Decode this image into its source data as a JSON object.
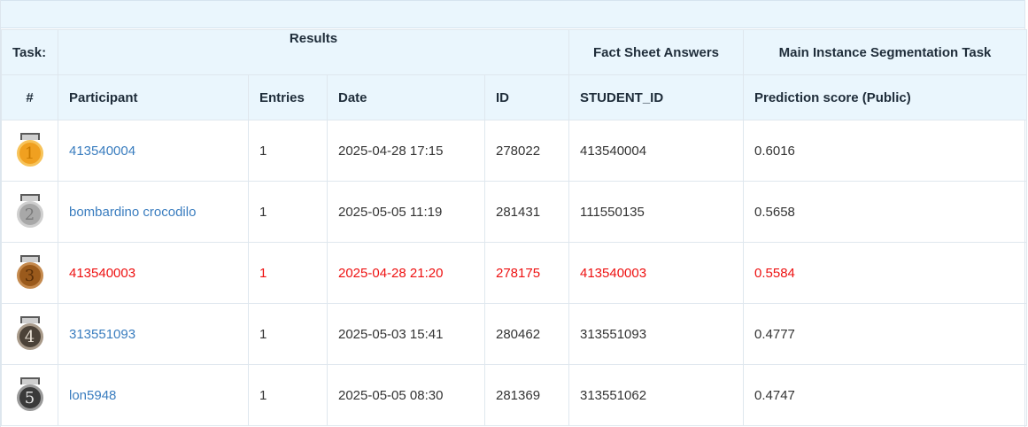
{
  "header": {
    "task_label": "Task:",
    "results_label": "Results",
    "fact_sheet_label": "Fact Sheet Answers",
    "main_task_label": "Main Instance Segmentation Task"
  },
  "columns": {
    "rank": "#",
    "participant": "Participant",
    "entries": "Entries",
    "date": "Date",
    "id": "ID",
    "student_id": "STUDENT_ID",
    "score": "Prediction score (Public)"
  },
  "rows": [
    {
      "rank": "1",
      "medal": "gold-medal-icon",
      "participant": "413540004",
      "entries": "1",
      "date": "2025-04-28 17:15",
      "id": "278022",
      "student_id": "413540004",
      "score": "0.6016"
    },
    {
      "rank": "2",
      "medal": "silver-medal-icon",
      "participant": "bombardino crocodilo",
      "entries": "1",
      "date": "2025-05-05 11:19",
      "id": "281431",
      "student_id": "111550135",
      "score": "0.5658"
    },
    {
      "rank": "3",
      "medal": "bronze-medal-icon",
      "participant": "413540003",
      "entries": "1",
      "date": "2025-04-28 21:20",
      "id": "278175",
      "student_id": "413540003",
      "score": "0.5584"
    },
    {
      "rank": "4",
      "medal": "rank-4-medal-icon",
      "participant": "313551093",
      "entries": "1",
      "date": "2025-05-03 15:41",
      "id": "280462",
      "student_id": "313551093",
      "score": "0.4777"
    },
    {
      "rank": "5",
      "medal": "rank-5-medal-icon",
      "participant": "lon5948",
      "entries": "1",
      "date": "2025-05-05 08:30",
      "id": "281369",
      "student_id": "313551062",
      "score": "0.4747"
    }
  ],
  "colors": {
    "header_bg": "#eaf6fd",
    "link": "#3a7dbf",
    "highlight": "#ee1111"
  }
}
